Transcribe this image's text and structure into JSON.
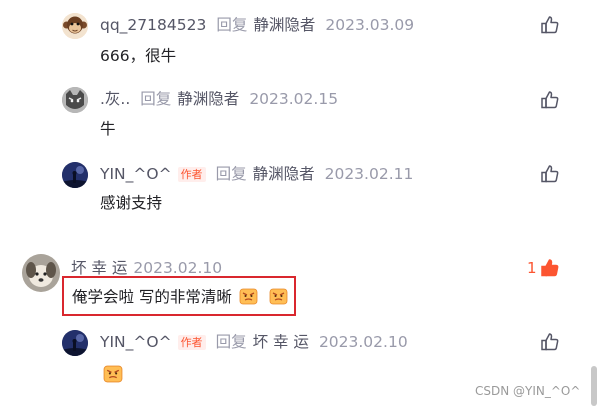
{
  "comments": [
    {
      "user": "qq_27184523",
      "reply_word": "回复",
      "target": "静渊隐者",
      "date": "2023.03.09",
      "text": "666，很牛"
    },
    {
      "user": ".灰..",
      "reply_word": "回复",
      "target": "静渊隐者",
      "date": "2023.02.15",
      "text": "牛"
    },
    {
      "user": "YIN_^O^",
      "badge": "作者",
      "reply_word": "回复",
      "target": "静渊隐者",
      "date": "2023.02.11",
      "text": "感谢支持"
    },
    {
      "user": "坏 幸 运",
      "date": "2023.02.10",
      "text": "俺学会啦 写的非常清晰",
      "likes": "1"
    },
    {
      "user": "YIN_^O^",
      "badge": "作者",
      "reply_word": "回复",
      "target": "坏 幸 运",
      "date": "2023.02.10",
      "text": ""
    }
  ],
  "icons": {
    "like": "thumbs-up-icon",
    "emoji": "face-emoji-icon"
  },
  "colors": {
    "accent": "#fc5531",
    "highlight_border": "#d9272e"
  },
  "watermark": "CSDN @YIN_^O^"
}
